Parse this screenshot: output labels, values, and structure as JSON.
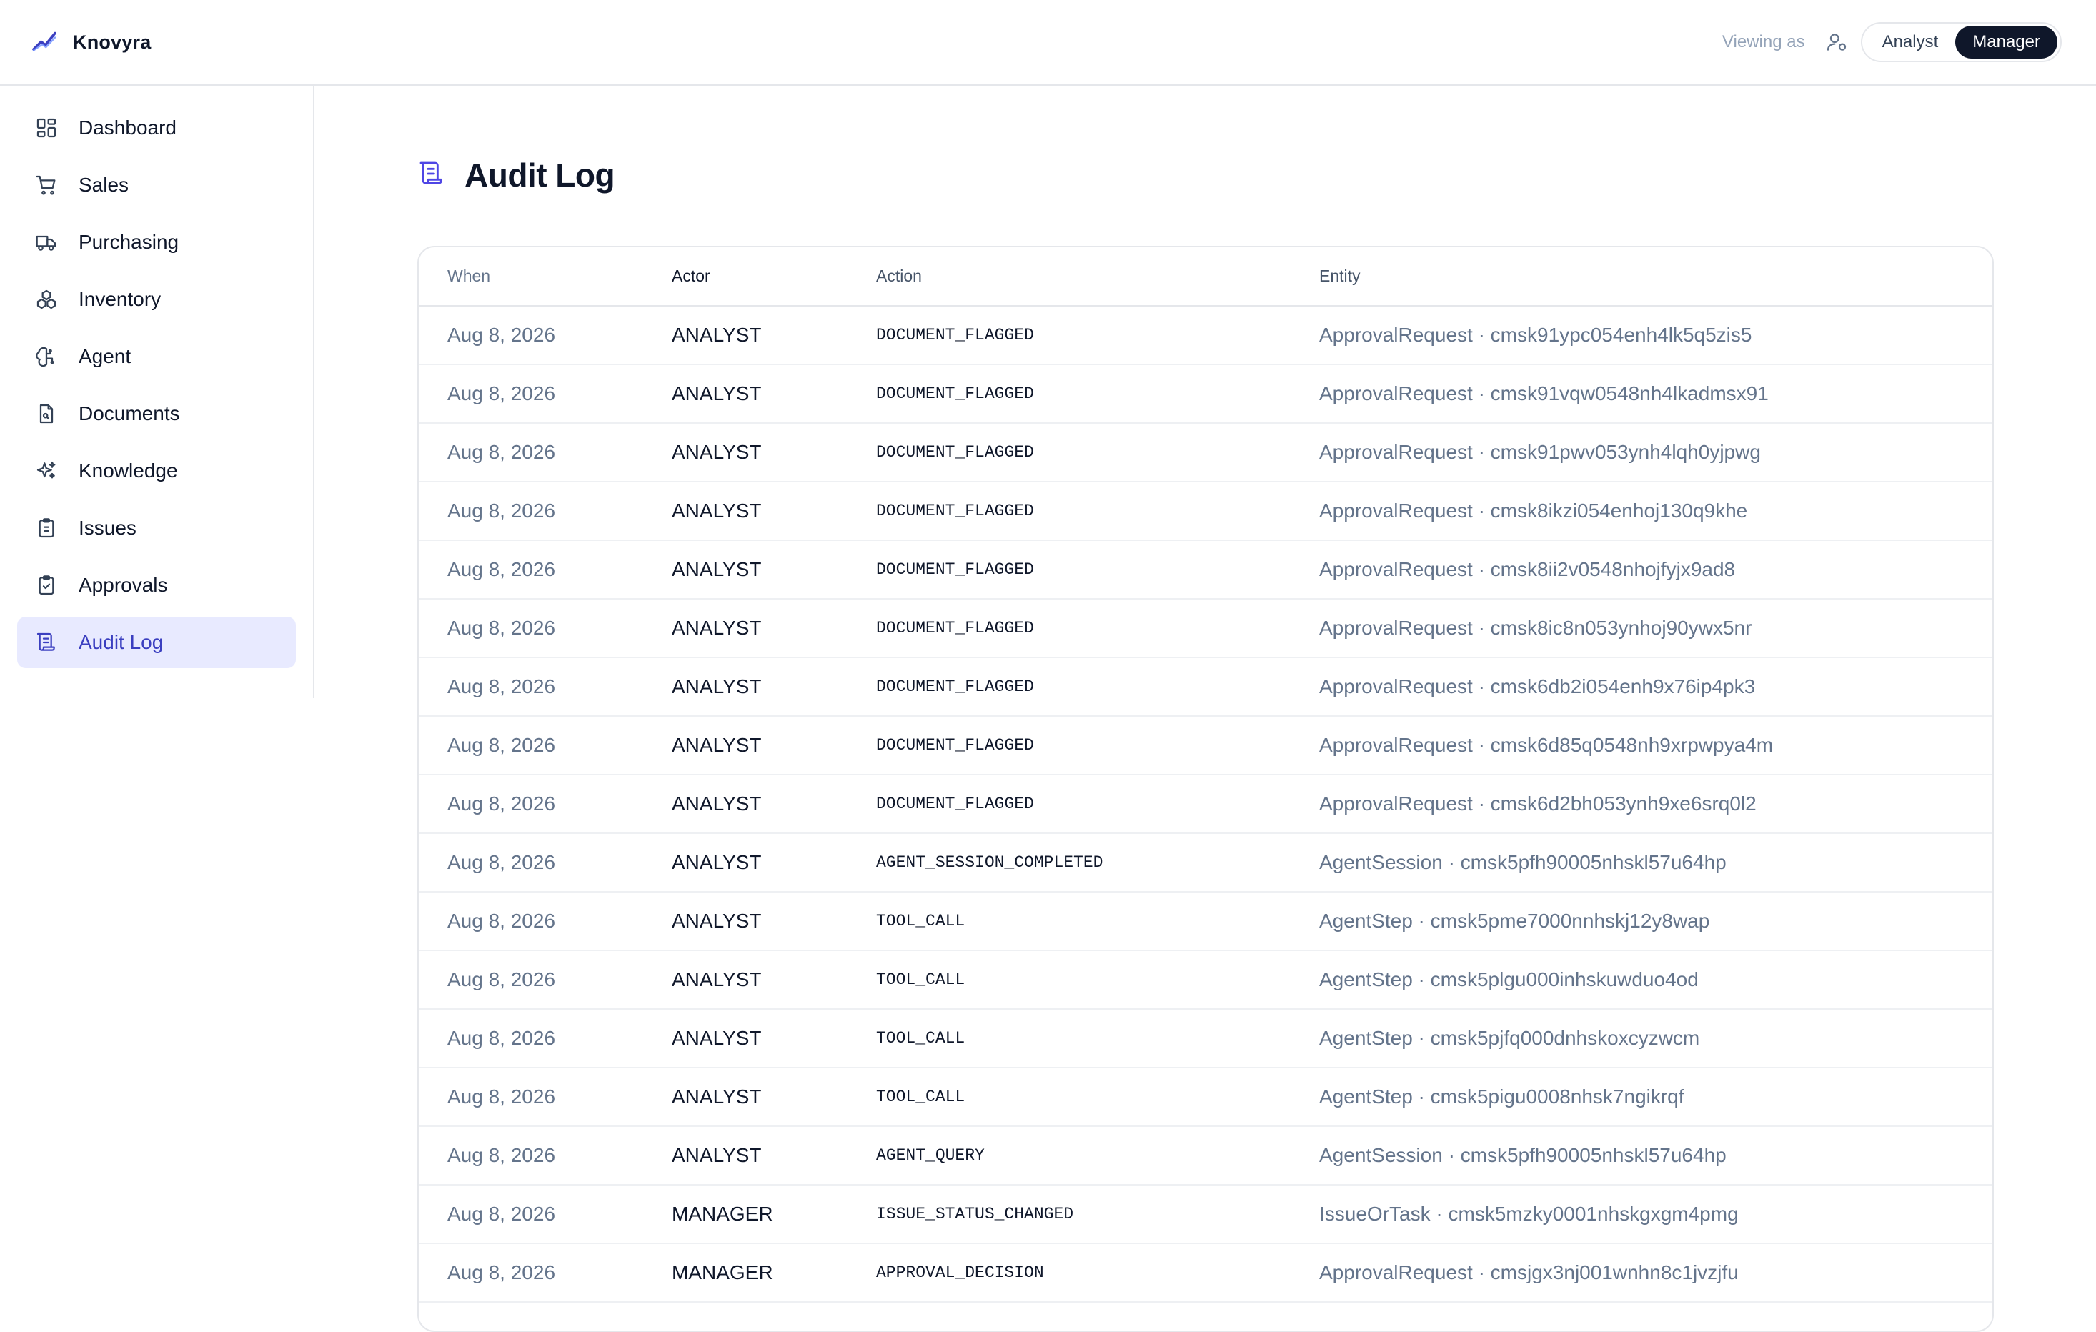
{
  "brand": {
    "name": "Knovyra",
    "icon": "chart-line-icon",
    "accent": "#3b3fc0"
  },
  "header": {
    "viewing_label": "Viewing as",
    "viewing_icon": "user-switch-icon",
    "roles": [
      {
        "label": "Analyst",
        "active": false
      },
      {
        "label": "Manager",
        "active": true
      }
    ]
  },
  "sidebar": {
    "items": [
      {
        "label": "Dashboard",
        "icon": "dashboard-icon",
        "active": false
      },
      {
        "label": "Sales",
        "icon": "cart-icon",
        "active": false
      },
      {
        "label": "Purchasing",
        "icon": "truck-icon",
        "active": false
      },
      {
        "label": "Inventory",
        "icon": "boxes-icon",
        "active": false
      },
      {
        "label": "Agent",
        "icon": "brain-icon",
        "active": false
      },
      {
        "label": "Documents",
        "icon": "document-icon",
        "active": false
      },
      {
        "label": "Knowledge",
        "icon": "sparkles-icon",
        "active": false
      },
      {
        "label": "Issues",
        "icon": "clipboard-list-icon",
        "active": false
      },
      {
        "label": "Approvals",
        "icon": "clipboard-check-icon",
        "active": false
      },
      {
        "label": "Audit Log",
        "icon": "scroll-icon",
        "active": true
      }
    ]
  },
  "page": {
    "title": "Audit Log",
    "icon": "scroll-icon"
  },
  "table": {
    "headers": {
      "when": "When",
      "actor": "Actor",
      "action": "Action",
      "entity": "Entity"
    },
    "rows": [
      {
        "when": "Aug 8, 2026",
        "actor": "ANALYST",
        "action": "DOCUMENT_FLAGGED",
        "entity": "ApprovalRequest · cmsk91ypc054enh4lk5q5zis5"
      },
      {
        "when": "Aug 8, 2026",
        "actor": "ANALYST",
        "action": "DOCUMENT_FLAGGED",
        "entity": "ApprovalRequest · cmsk91vqw0548nh4lkadmsx91"
      },
      {
        "when": "Aug 8, 2026",
        "actor": "ANALYST",
        "action": "DOCUMENT_FLAGGED",
        "entity": "ApprovalRequest · cmsk91pwv053ynh4lqh0yjpwg"
      },
      {
        "when": "Aug 8, 2026",
        "actor": "ANALYST",
        "action": "DOCUMENT_FLAGGED",
        "entity": "ApprovalRequest · cmsk8ikzi054enhoj130q9khe"
      },
      {
        "when": "Aug 8, 2026",
        "actor": "ANALYST",
        "action": "DOCUMENT_FLAGGED",
        "entity": "ApprovalRequest · cmsk8ii2v0548nhojfyjx9ad8"
      },
      {
        "when": "Aug 8, 2026",
        "actor": "ANALYST",
        "action": "DOCUMENT_FLAGGED",
        "entity": "ApprovalRequest · cmsk8ic8n053ynhoj90ywx5nr"
      },
      {
        "when": "Aug 8, 2026",
        "actor": "ANALYST",
        "action": "DOCUMENT_FLAGGED",
        "entity": "ApprovalRequest · cmsk6db2i054enh9x76ip4pk3"
      },
      {
        "when": "Aug 8, 2026",
        "actor": "ANALYST",
        "action": "DOCUMENT_FLAGGED",
        "entity": "ApprovalRequest · cmsk6d85q0548nh9xrpwpya4m"
      },
      {
        "when": "Aug 8, 2026",
        "actor": "ANALYST",
        "action": "DOCUMENT_FLAGGED",
        "entity": "ApprovalRequest · cmsk6d2bh053ynh9xe6srq0l2"
      },
      {
        "when": "Aug 8, 2026",
        "actor": "ANALYST",
        "action": "AGENT_SESSION_COMPLETED",
        "entity": "AgentSession · cmsk5pfh90005nhskl57u64hp"
      },
      {
        "when": "Aug 8, 2026",
        "actor": "ANALYST",
        "action": "TOOL_CALL",
        "entity": "AgentStep · cmsk5pme7000nnhskj12y8wap"
      },
      {
        "when": "Aug 8, 2026",
        "actor": "ANALYST",
        "action": "TOOL_CALL",
        "entity": "AgentStep · cmsk5plgu000inhskuwduo4od"
      },
      {
        "when": "Aug 8, 2026",
        "actor": "ANALYST",
        "action": "TOOL_CALL",
        "entity": "AgentStep · cmsk5pjfq000dnhskoxcyzwcm"
      },
      {
        "when": "Aug 8, 2026",
        "actor": "ANALYST",
        "action": "TOOL_CALL",
        "entity": "AgentStep · cmsk5pigu0008nhsk7ngikrqf"
      },
      {
        "when": "Aug 8, 2026",
        "actor": "ANALYST",
        "action": "AGENT_QUERY",
        "entity": "AgentSession · cmsk5pfh90005nhskl57u64hp"
      },
      {
        "when": "Aug 8, 2026",
        "actor": "MANAGER",
        "action": "ISSUE_STATUS_CHANGED",
        "entity": "IssueOrTask · cmsk5mzky0001nhskgxgm4pmg"
      },
      {
        "when": "Aug 8, 2026",
        "actor": "MANAGER",
        "action": "APPROVAL_DECISION",
        "entity": "ApprovalRequest · cmsjgx3nj001wnhn8c1jvzjfu"
      }
    ]
  }
}
